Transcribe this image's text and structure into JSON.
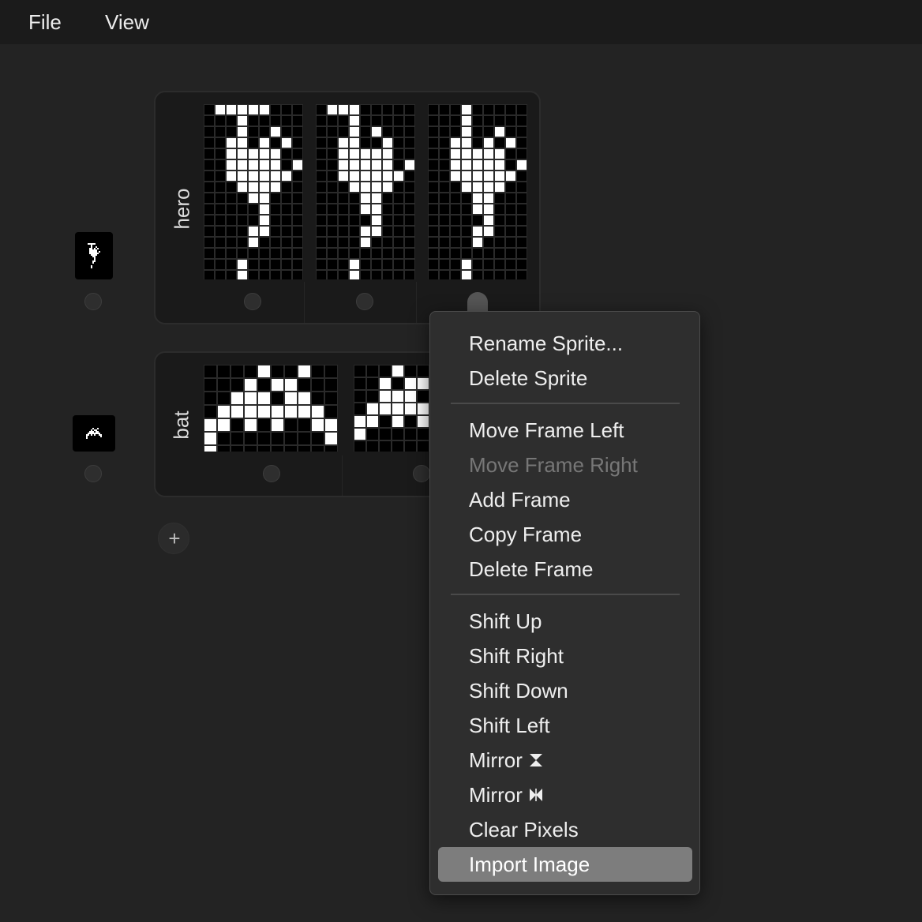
{
  "menubar": {
    "file_label": "File",
    "view_label": "View"
  },
  "colors": {
    "background": "#232323",
    "menubar": "#1b1b1b",
    "card": "#1a1a1a",
    "pixel_on": "#ffffff",
    "pixel_off": "#000000",
    "grid_line": "#2a2a2a",
    "menu_bg": "#2e2e2e",
    "menu_highlight": "#7d7d7d"
  },
  "sprites": [
    {
      "name": "hero",
      "thumbnail_icon": "hero-sprite-icon",
      "frames": [
        {
          "cols": 8,
          "pixels": [
            "11111000",
            "00100000",
            "00100100",
            "01101010",
            "01111100",
            "01111101",
            "01111110",
            "00111100",
            "00011000",
            "00001000",
            "00001000",
            "00011000",
            "00010000",
            "00000000",
            "00100000",
            "00100000"
          ]
        },
        {
          "cols": 8,
          "pixels": [
            "11100000",
            "00100000",
            "00101000",
            "01100100",
            "01111100",
            "01111101",
            "01111110",
            "00111100",
            "00011000",
            "00011000",
            "00001000",
            "00011000",
            "00010000",
            "00000000",
            "00100000",
            "00100000"
          ]
        },
        {
          "cols": 8,
          "pixels": [
            "00100000",
            "00100000",
            "00100100",
            "01101010",
            "01111100",
            "01111101",
            "01111110",
            "00111100",
            "00011000",
            "00011000",
            "00001000",
            "00011000",
            "00010000",
            "00000000",
            "00100000",
            "00100000"
          ]
        }
      ]
    },
    {
      "name": "bat",
      "thumbnail_icon": "bat-sprite-icon",
      "frames": [
        {
          "cols": 10,
          "pixels": [
            "0000100100",
            "0001011000",
            "0011101100",
            "0111111110",
            "1101010011",
            "1000000001",
            "1000000000",
            "0000000000"
          ]
        },
        {
          "cols": 6,
          "pixels": [
            "000100",
            "001011",
            "001110",
            "011111",
            "110101",
            "100000",
            "000000",
            "000000"
          ]
        }
      ]
    }
  ],
  "add_sprite_label": "+",
  "context_menu": {
    "items": [
      {
        "label": "Rename Sprite...",
        "disabled": false
      },
      {
        "label": "Delete Sprite",
        "disabled": false
      },
      {
        "label": "Move Frame Left",
        "disabled": false
      },
      {
        "label": "Move Frame Right",
        "disabled": true
      },
      {
        "label": "Add Frame",
        "disabled": false
      },
      {
        "label": "Copy Frame",
        "disabled": false
      },
      {
        "label": "Delete Frame",
        "disabled": false
      },
      {
        "label": "Shift Up",
        "disabled": false
      },
      {
        "label": "Shift Right",
        "disabled": false
      },
      {
        "label": "Shift Down",
        "disabled": false
      },
      {
        "label": "Shift Left",
        "disabled": false
      },
      {
        "label": "Mirror",
        "disabled": false,
        "icon": "mirror-vertical-icon"
      },
      {
        "label": "Mirror",
        "disabled": false,
        "icon": "mirror-horizontal-icon"
      },
      {
        "label": "Clear Pixels",
        "disabled": false
      },
      {
        "label": "Import Image",
        "disabled": false,
        "highlighted": true
      }
    ]
  }
}
